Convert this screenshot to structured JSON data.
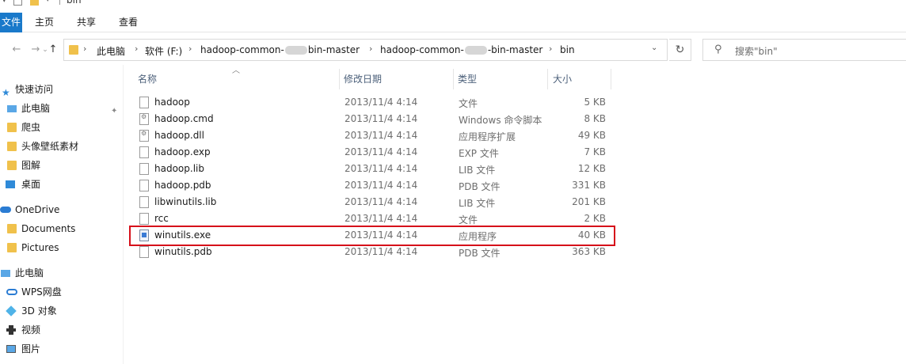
{
  "window": {
    "title": "bin"
  },
  "ribbon": {
    "tabs": [
      "文件",
      "主页",
      "共享",
      "查看"
    ]
  },
  "address": {
    "breadcrumbs": [
      "此电脑",
      "软件 (F:)",
      "hadoop-common-",
      "bin-master",
      "hadoop-common-",
      "-bin-master",
      "bin"
    ],
    "search_placeholder": "搜索\"bin\""
  },
  "sidebar": {
    "items": [
      {
        "label": "快速访问",
        "icon": "star-icon"
      },
      {
        "label": "此电脑",
        "icon": "computer-icon"
      },
      {
        "label": "爬虫",
        "icon": "folder-icon"
      },
      {
        "label": "头像壁纸素材",
        "icon": "folder-icon"
      },
      {
        "label": "图解",
        "icon": "folder-icon"
      },
      {
        "label": "桌面",
        "icon": "desktop-icon"
      },
      {
        "label": "OneDrive",
        "icon": "cloud-icon"
      },
      {
        "label": "Documents",
        "icon": "folder-icon"
      },
      {
        "label": "Pictures",
        "icon": "folder-icon"
      },
      {
        "label": "此电脑",
        "icon": "computer-icon"
      },
      {
        "label": "WPS网盘",
        "icon": "cloud-icon"
      },
      {
        "label": "3D 对象",
        "icon": "cube-icon"
      },
      {
        "label": "视频",
        "icon": "video-icon"
      },
      {
        "label": "图片",
        "icon": "picture-icon"
      }
    ]
  },
  "columns": {
    "name": "名称",
    "date": "修改日期",
    "type": "类型",
    "size": "大小"
  },
  "files": [
    {
      "name": "hadoop",
      "date": "2013/11/4 4:14",
      "type": "文件",
      "size": "5 KB"
    },
    {
      "name": "hadoop.cmd",
      "date": "2013/11/4 4:14",
      "type": "Windows 命令脚本",
      "size": "8 KB"
    },
    {
      "name": "hadoop.dll",
      "date": "2013/11/4 4:14",
      "type": "应用程序扩展",
      "size": "49 KB"
    },
    {
      "name": "hadoop.exp",
      "date": "2013/11/4 4:14",
      "type": "EXP 文件",
      "size": "7 KB"
    },
    {
      "name": "hadoop.lib",
      "date": "2013/11/4 4:14",
      "type": "LIB 文件",
      "size": "12 KB"
    },
    {
      "name": "hadoop.pdb",
      "date": "2013/11/4 4:14",
      "type": "PDB 文件",
      "size": "331 KB"
    },
    {
      "name": "libwinutils.lib",
      "date": "2013/11/4 4:14",
      "type": "LIB 文件",
      "size": "201 KB"
    },
    {
      "name": "rcc",
      "date": "2013/11/4 4:14",
      "type": "文件",
      "size": "2 KB"
    },
    {
      "name": "winutils.exe",
      "date": "2013/11/4 4:14",
      "type": "应用程序",
      "size": "40 KB"
    },
    {
      "name": "winutils.pdb",
      "date": "2013/11/4 4:14",
      "type": "PDB 文件",
      "size": "363 KB"
    }
  ],
  "colors": {
    "accent": "#1979ca",
    "highlight_box": "#d6101a",
    "folder": "#f0c14b"
  }
}
